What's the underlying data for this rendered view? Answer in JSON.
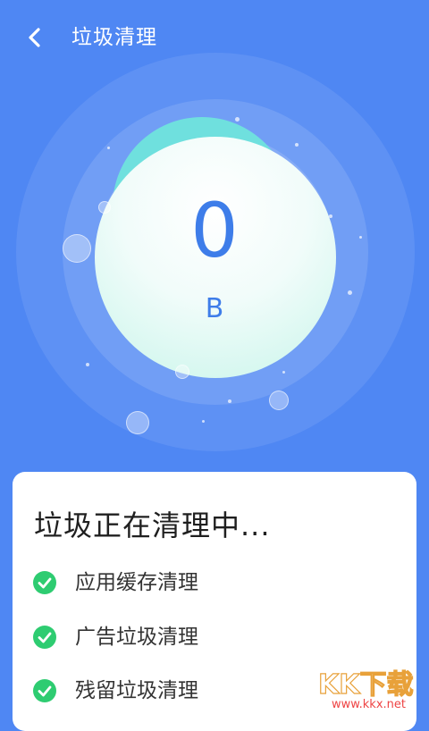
{
  "header": {
    "title": "垃圾清理"
  },
  "scan": {
    "size_value": "0",
    "size_unit": "B"
  },
  "card": {
    "title": "垃圾正在清理中...",
    "steps": [
      {
        "label": "应用缓存清理",
        "status": "done"
      },
      {
        "label": "广告垃圾清理",
        "status": "done"
      },
      {
        "label": "残留垃圾清理",
        "status": "done"
      }
    ]
  },
  "colors": {
    "background": "#4f87f3",
    "accent": "#3e7de9",
    "check": "#2ecc71",
    "orb_tint": "#6fe0de"
  },
  "icons": {
    "back": "chevron-left-icon",
    "step_done": "check-circle-icon"
  },
  "watermark": {
    "logo_text": "KK下载",
    "site": "www.kkx.net"
  }
}
